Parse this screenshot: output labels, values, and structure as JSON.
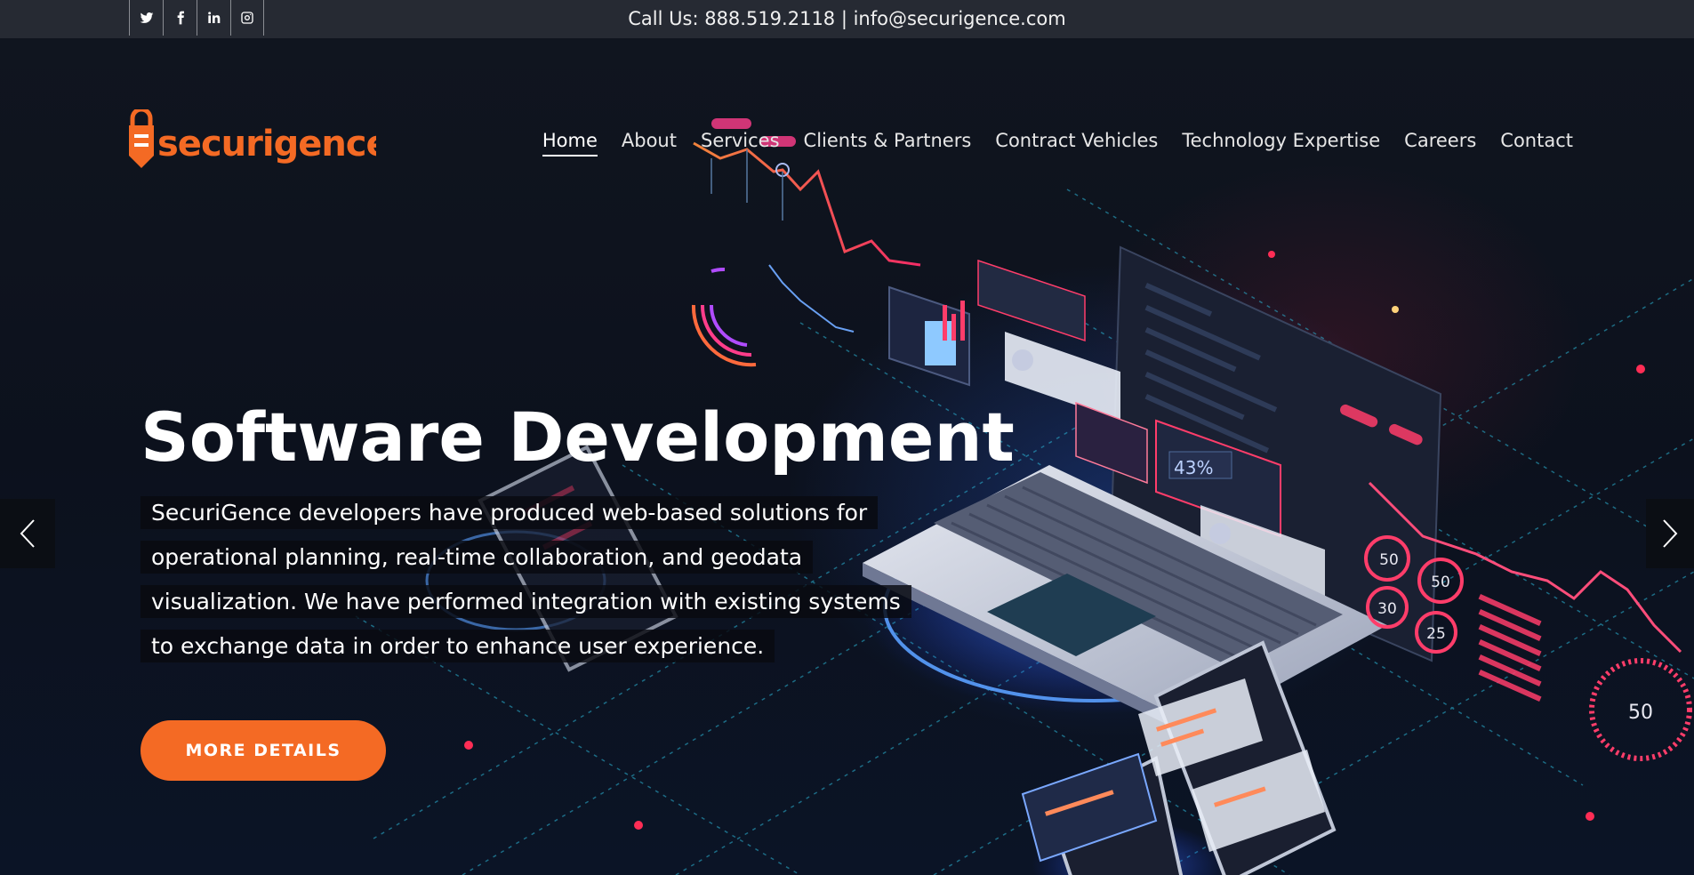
{
  "topbar": {
    "social": [
      {
        "icon": "twitter-icon",
        "glyph": "twitter"
      },
      {
        "icon": "facebook-icon",
        "glyph": "f"
      },
      {
        "icon": "linkedin-icon",
        "glyph": "in"
      },
      {
        "icon": "instagram-icon",
        "glyph": "instagram"
      }
    ],
    "contact": "Call Us: 888.519.2118 | info@securigence.com"
  },
  "header": {
    "logo_text": "securigence",
    "nav": [
      {
        "label": "Home",
        "active": true
      },
      {
        "label": "About"
      },
      {
        "label": "Services"
      },
      {
        "label": "Clients & Partners"
      },
      {
        "label": "Contract Vehicles"
      },
      {
        "label": "Technology Expertise"
      },
      {
        "label": "Careers"
      },
      {
        "label": "Contact"
      }
    ]
  },
  "slide": {
    "title": "Software Development",
    "description_lines": [
      "SecuriGence developers have produced web-based solutions for",
      "operational planning, real-time collaboration, and geodata",
      "visualization. We have performed integration with existing systems",
      "to exchange data in order to enhance user experience."
    ],
    "cta_label": "MORE DETAILS",
    "art_labels": {
      "percent": "43%",
      "badge1": "50",
      "badge2": "50",
      "badge3": "30",
      "badge4": "25",
      "badge5": "50"
    }
  },
  "colors": {
    "accent": "#f46a24",
    "topbar": "#262a33",
    "background": "#0d1220"
  }
}
